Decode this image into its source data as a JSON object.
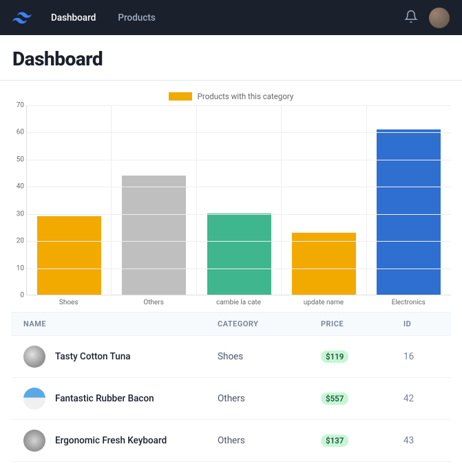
{
  "nav": {
    "links": [
      "Dashboard",
      "Products"
    ],
    "active": 0
  },
  "page_title": "Dashboard",
  "chart_data": {
    "type": "bar",
    "legend": "Products with this category",
    "categories": [
      "Shoes",
      "Others",
      "cambie la cate",
      "update name",
      "Electronics"
    ],
    "values": [
      29,
      44,
      30,
      23,
      61
    ],
    "colors": [
      "#f2a900",
      "#bfbfbf",
      "#3fb68e",
      "#f2a900",
      "#2f6fd0"
    ],
    "ylim": [
      0,
      70
    ],
    "yticks": [
      0,
      10,
      20,
      30,
      40,
      50,
      60,
      70
    ],
    "xlabel": "",
    "ylabel": ""
  },
  "table": {
    "headers": {
      "name": "NAME",
      "category": "CATEGORY",
      "price": "PRICE",
      "id": "ID"
    },
    "rows": [
      {
        "name": "Tasty Cotton Tuna",
        "category": "Shoes",
        "price": "$119",
        "id": "16"
      },
      {
        "name": "Fantastic Rubber Bacon",
        "category": "Others",
        "price": "$557",
        "id": "42"
      },
      {
        "name": "Ergonomic Fresh Keyboard",
        "category": "Others",
        "price": "$137",
        "id": "43"
      }
    ]
  }
}
